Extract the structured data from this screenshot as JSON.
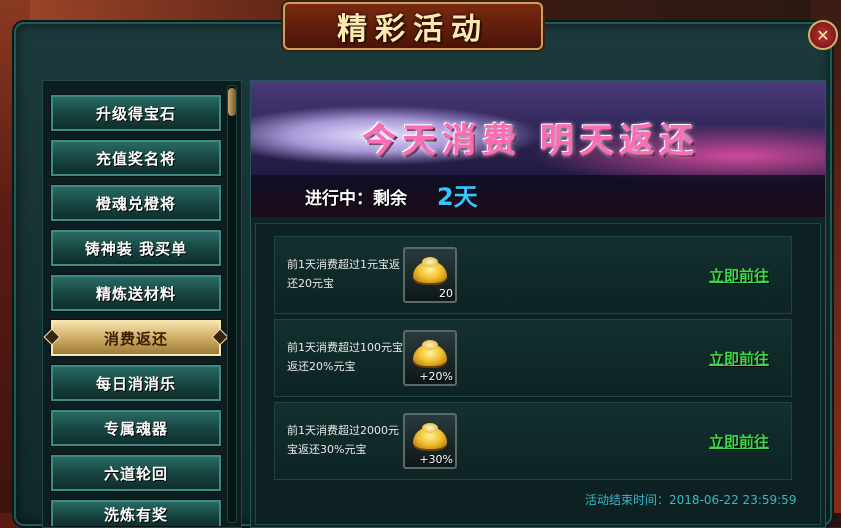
{
  "window": {
    "title": "精彩活动",
    "close_icon": "close-icon"
  },
  "menu": {
    "items": [
      {
        "label": "升级得宝石",
        "active": false
      },
      {
        "label": "充值奖名将",
        "active": false
      },
      {
        "label": "橙魂兑橙将",
        "active": false
      },
      {
        "label": "铸神装 我买单",
        "active": false
      },
      {
        "label": "精炼送材料",
        "active": false
      },
      {
        "label": "消费返还",
        "active": true
      },
      {
        "label": "每日消消乐",
        "active": false
      },
      {
        "label": "专属魂器",
        "active": false
      },
      {
        "label": "六道轮回",
        "active": false
      },
      {
        "label": "洗炼有奖",
        "active": false
      }
    ]
  },
  "activity": {
    "banner_title": "今天消费 明天返还",
    "status_label": "进行中：剩余",
    "status_days": "2天",
    "rows": [
      {
        "desc": "前1天消费超过1元宝返还20元宝",
        "reward": "20",
        "icon": "gold-ingot-icon",
        "action": "立即前往"
      },
      {
        "desc": "前1天消费超过100元宝返还20%元宝",
        "reward": "+20%",
        "icon": "gold-ingot-icon",
        "action": "立即前往"
      },
      {
        "desc": "前1天消费超过2000元宝返还30%元宝",
        "reward": "+30%",
        "icon": "gold-ingot-icon",
        "action": "立即前往"
      }
    ],
    "end_time": "活动结束时间：2018-06-22 23:59:59"
  },
  "colors": {
    "accent_gold": "#c9a060",
    "link_green": "#3fd64a",
    "days_blue": "#33c8ff",
    "panel_teal": "#1f5a55"
  }
}
